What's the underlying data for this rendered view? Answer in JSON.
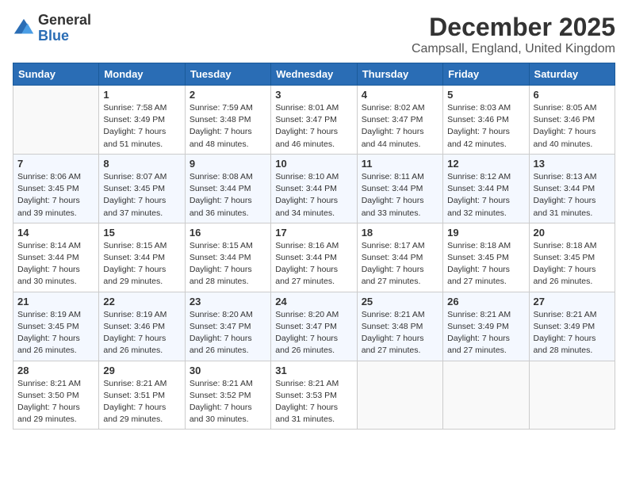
{
  "header": {
    "logo_general": "General",
    "logo_blue": "Blue",
    "month": "December 2025",
    "location": "Campsall, England, United Kingdom"
  },
  "days_of_week": [
    "Sunday",
    "Monday",
    "Tuesday",
    "Wednesday",
    "Thursday",
    "Friday",
    "Saturday"
  ],
  "weeks": [
    [
      {
        "day": "",
        "empty": true
      },
      {
        "day": "1",
        "sunrise": "Sunrise: 7:58 AM",
        "sunset": "Sunset: 3:49 PM",
        "daylight": "Daylight: 7 hours and 51 minutes."
      },
      {
        "day": "2",
        "sunrise": "Sunrise: 7:59 AM",
        "sunset": "Sunset: 3:48 PM",
        "daylight": "Daylight: 7 hours and 48 minutes."
      },
      {
        "day": "3",
        "sunrise": "Sunrise: 8:01 AM",
        "sunset": "Sunset: 3:47 PM",
        "daylight": "Daylight: 7 hours and 46 minutes."
      },
      {
        "day": "4",
        "sunrise": "Sunrise: 8:02 AM",
        "sunset": "Sunset: 3:47 PM",
        "daylight": "Daylight: 7 hours and 44 minutes."
      },
      {
        "day": "5",
        "sunrise": "Sunrise: 8:03 AM",
        "sunset": "Sunset: 3:46 PM",
        "daylight": "Daylight: 7 hours and 42 minutes."
      },
      {
        "day": "6",
        "sunrise": "Sunrise: 8:05 AM",
        "sunset": "Sunset: 3:46 PM",
        "daylight": "Daylight: 7 hours and 40 minutes."
      }
    ],
    [
      {
        "day": "7",
        "sunrise": "Sunrise: 8:06 AM",
        "sunset": "Sunset: 3:45 PM",
        "daylight": "Daylight: 7 hours and 39 minutes."
      },
      {
        "day": "8",
        "sunrise": "Sunrise: 8:07 AM",
        "sunset": "Sunset: 3:45 PM",
        "daylight": "Daylight: 7 hours and 37 minutes."
      },
      {
        "day": "9",
        "sunrise": "Sunrise: 8:08 AM",
        "sunset": "Sunset: 3:44 PM",
        "daylight": "Daylight: 7 hours and 36 minutes."
      },
      {
        "day": "10",
        "sunrise": "Sunrise: 8:10 AM",
        "sunset": "Sunset: 3:44 PM",
        "daylight": "Daylight: 7 hours and 34 minutes."
      },
      {
        "day": "11",
        "sunrise": "Sunrise: 8:11 AM",
        "sunset": "Sunset: 3:44 PM",
        "daylight": "Daylight: 7 hours and 33 minutes."
      },
      {
        "day": "12",
        "sunrise": "Sunrise: 8:12 AM",
        "sunset": "Sunset: 3:44 PM",
        "daylight": "Daylight: 7 hours and 32 minutes."
      },
      {
        "day": "13",
        "sunrise": "Sunrise: 8:13 AM",
        "sunset": "Sunset: 3:44 PM",
        "daylight": "Daylight: 7 hours and 31 minutes."
      }
    ],
    [
      {
        "day": "14",
        "sunrise": "Sunrise: 8:14 AM",
        "sunset": "Sunset: 3:44 PM",
        "daylight": "Daylight: 7 hours and 30 minutes."
      },
      {
        "day": "15",
        "sunrise": "Sunrise: 8:15 AM",
        "sunset": "Sunset: 3:44 PM",
        "daylight": "Daylight: 7 hours and 29 minutes."
      },
      {
        "day": "16",
        "sunrise": "Sunrise: 8:15 AM",
        "sunset": "Sunset: 3:44 PM",
        "daylight": "Daylight: 7 hours and 28 minutes."
      },
      {
        "day": "17",
        "sunrise": "Sunrise: 8:16 AM",
        "sunset": "Sunset: 3:44 PM",
        "daylight": "Daylight: 7 hours and 27 minutes."
      },
      {
        "day": "18",
        "sunrise": "Sunrise: 8:17 AM",
        "sunset": "Sunset: 3:44 PM",
        "daylight": "Daylight: 7 hours and 27 minutes."
      },
      {
        "day": "19",
        "sunrise": "Sunrise: 8:18 AM",
        "sunset": "Sunset: 3:45 PM",
        "daylight": "Daylight: 7 hours and 27 minutes."
      },
      {
        "day": "20",
        "sunrise": "Sunrise: 8:18 AM",
        "sunset": "Sunset: 3:45 PM",
        "daylight": "Daylight: 7 hours and 26 minutes."
      }
    ],
    [
      {
        "day": "21",
        "sunrise": "Sunrise: 8:19 AM",
        "sunset": "Sunset: 3:45 PM",
        "daylight": "Daylight: 7 hours and 26 minutes."
      },
      {
        "day": "22",
        "sunrise": "Sunrise: 8:19 AM",
        "sunset": "Sunset: 3:46 PM",
        "daylight": "Daylight: 7 hours and 26 minutes."
      },
      {
        "day": "23",
        "sunrise": "Sunrise: 8:20 AM",
        "sunset": "Sunset: 3:47 PM",
        "daylight": "Daylight: 7 hours and 26 minutes."
      },
      {
        "day": "24",
        "sunrise": "Sunrise: 8:20 AM",
        "sunset": "Sunset: 3:47 PM",
        "daylight": "Daylight: 7 hours and 26 minutes."
      },
      {
        "day": "25",
        "sunrise": "Sunrise: 8:21 AM",
        "sunset": "Sunset: 3:48 PM",
        "daylight": "Daylight: 7 hours and 27 minutes."
      },
      {
        "day": "26",
        "sunrise": "Sunrise: 8:21 AM",
        "sunset": "Sunset: 3:49 PM",
        "daylight": "Daylight: 7 hours and 27 minutes."
      },
      {
        "day": "27",
        "sunrise": "Sunrise: 8:21 AM",
        "sunset": "Sunset: 3:49 PM",
        "daylight": "Daylight: 7 hours and 28 minutes."
      }
    ],
    [
      {
        "day": "28",
        "sunrise": "Sunrise: 8:21 AM",
        "sunset": "Sunset: 3:50 PM",
        "daylight": "Daylight: 7 hours and 29 minutes."
      },
      {
        "day": "29",
        "sunrise": "Sunrise: 8:21 AM",
        "sunset": "Sunset: 3:51 PM",
        "daylight": "Daylight: 7 hours and 29 minutes."
      },
      {
        "day": "30",
        "sunrise": "Sunrise: 8:21 AM",
        "sunset": "Sunset: 3:52 PM",
        "daylight": "Daylight: 7 hours and 30 minutes."
      },
      {
        "day": "31",
        "sunrise": "Sunrise: 8:21 AM",
        "sunset": "Sunset: 3:53 PM",
        "daylight": "Daylight: 7 hours and 31 minutes."
      },
      {
        "day": "",
        "empty": true
      },
      {
        "day": "",
        "empty": true
      },
      {
        "day": "",
        "empty": true
      }
    ]
  ]
}
